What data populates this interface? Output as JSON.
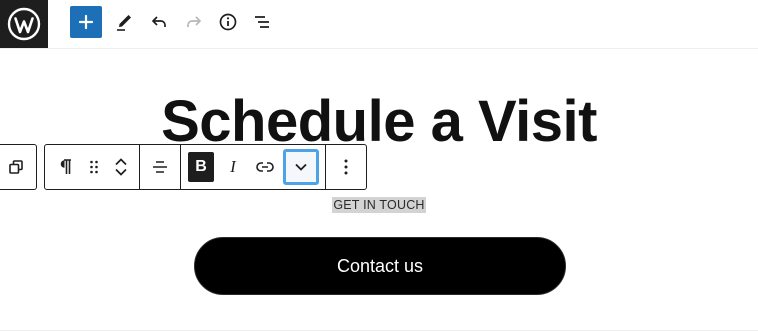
{
  "header": {
    "icons": [
      "wordpress-logo-icon",
      "plus-icon",
      "pencil-icon",
      "undo-icon",
      "redo-icon",
      "info-icon",
      "list-view-icon"
    ]
  },
  "canvas": {
    "heading": "Schedule a Visit",
    "eyebrow": "GET IN TOUCH",
    "button_label": "Contact us"
  },
  "block_toolbar": {
    "bold_label": "B",
    "italic_label": "I",
    "icons": [
      "select-parent-icon",
      "paragraph-icon",
      "drag-handle-icon",
      "move-up-icon",
      "move-down-icon",
      "align-icon",
      "link-icon",
      "chevron-down-icon",
      "more-options-icon"
    ]
  },
  "colors": {
    "accent": "#1d70b8",
    "focus_ring": "#4da3e6",
    "dark": "#1e1e1e",
    "button_bg": "#000000",
    "text_highlight": "#d3d3d3"
  }
}
